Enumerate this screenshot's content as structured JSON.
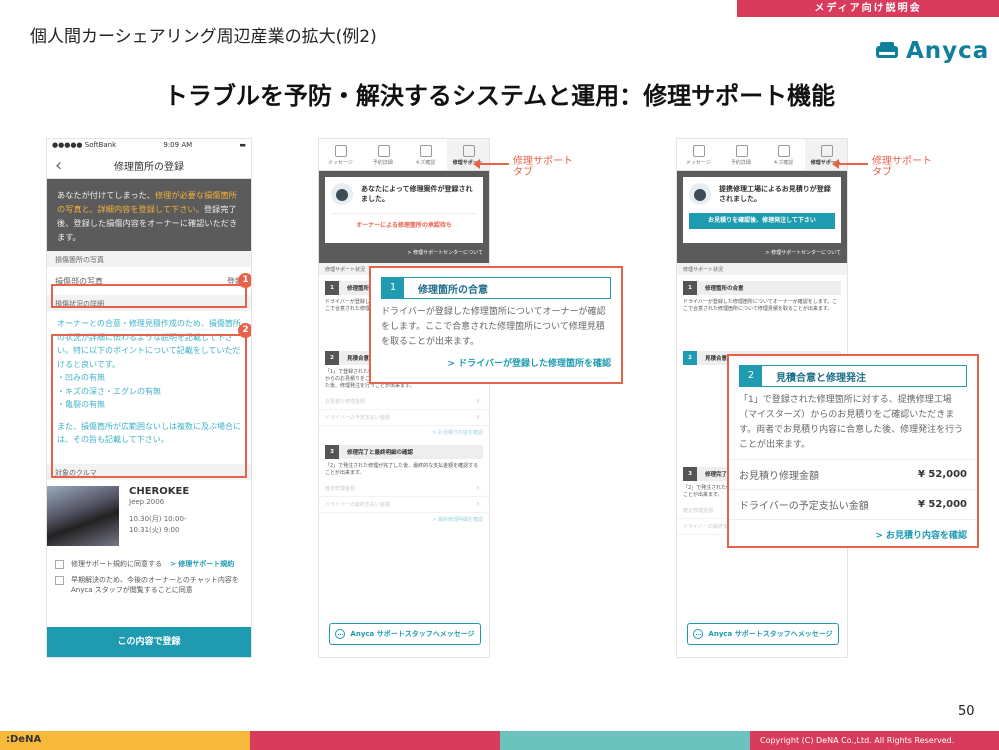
{
  "header": {
    "badge": "メディア向け説明会",
    "subtitle": "個人間カーシェアリング周辺産業の拡大(例2)",
    "logo_text": "Anyca",
    "title": "トラブルを予防・解決するシステムと運用：修理サポート機能"
  },
  "phone1": {
    "status_carrier": "●●●●● SoftBank",
    "status_time": "9:09 AM",
    "nav_title": "修理箇所の登録",
    "intro_1": "あなたが付けてしまった、",
    "intro_hl": "修理が必要な損傷箇所の写真と、詳細内容を登録して下さい。",
    "intro_2": "登録完了後、登録した損傷内容をオーナーに確認いただきます。",
    "photo_section": "損傷箇所の写真",
    "photo_field": "損傷部の写真",
    "photo_action": "登録",
    "detail_section": "損傷状況の詳細",
    "detail_text_1": "オーナーとの合意・修理見積作成のため、損傷箇所の状況が詳細に伝わるような説明を記載して下さい。特に以下のポイントについて記載をしていただけると良いです。",
    "detail_points": [
      "・凹みの有無",
      "・キズの深さ・エグレの有無",
      "・亀裂の有無"
    ],
    "detail_text_2": "また、損傷箇所が広範囲ないしは複数に及ぶ場合には、その旨も記載して下さい。",
    "car_section": "対象のクルマ",
    "car_name": "CHEROKEE",
    "car_model": "Jeep 2006",
    "car_date_1": "10.30(月) 10:00-",
    "car_date_2": "10.31(火) 9:00",
    "check_1": "修理サポート規約に同意する",
    "check_1_link": "> 修理サポート規約",
    "check_2": "早期解決のため、今後のオーナーとのチャット内容を Anyca スタッフが閲覧することに同意",
    "submit": "この内容で登録",
    "marker_1": "1",
    "marker_2": "2"
  },
  "tabs": [
    "メッセージ",
    "予約詳細",
    "キズ確認",
    "修理サポート"
  ],
  "phone2": {
    "banner_msg": "あなたによって修理案件が登録されました。",
    "banner_status": "オーナーによる修理箇所の承認待ち",
    "banner_link": "> 修理サポートセンターについて",
    "status_label": "修理サポート状況",
    "step1": "修理箇所の合意",
    "step1_text": "ドライバーが登録した修理箇所についてオーナーが確認をします。ここで合意された修理箇所について修理見積を取ることが出来ます。",
    "step2": "見積合意と修理発注",
    "step2_text": "「1」で登録された修理箇所に対する、提携修理工場（マイスターズ）からのお見積りをご確認いただきます。両者でお見積り内容に合意した後、修理発注を行うことが出来ます。",
    "step2_row1": "お見積り修理金額",
    "step2_row2": "ドライバーの予定支払い金額",
    "step2_val": "¥ -",
    "step2_link": "> お見積り内容を確認",
    "step3": "修理完了と最終明細の確認",
    "step3_text": "「2」で発注された修理が完了した後、最終的な支払金額を確認することが出来ます。",
    "step3_row1": "確定修理金額",
    "step3_row2": "ドライバーの最終支払い金額",
    "step3_link": "> 最終修理明細を確認",
    "message_button": "Anyca サポートスタッフへメッセージ",
    "annot": "修理サポート\nタブ",
    "callout_num": "1",
    "callout_title": "修理箇所の合意",
    "callout_body": "ドライバーが登録した修理箇所についてオーナーが確認をします。ここで合意された修理箇所について修理見積を取ることが出来ます。",
    "callout_link": "> ドライバーが登録した修理箇所を確認"
  },
  "phone3": {
    "banner_msg": "提携修理工場によるお見積りが登録されました。",
    "banner_button": "お見積りを確認後、修理発注して下さい",
    "banner_link": "> 修理サポートセンターについて",
    "status_label": "修理サポート状況",
    "step1": "修理箇所の合意",
    "step1_text": "ドライバーが登録した修理箇所についてオーナーが確認をします。ここで合意された修理箇所について修理見積を取ることが出来ます。",
    "step2": "見積合意と修理発注",
    "step3": "修理完了と最終明細の確認",
    "step3_text": "「2」で発注された修理が完了した後、最終的な支払金額を確認することが出来ます。",
    "step3_row1": "確定修理金額",
    "step3_row2": "ドライバーの最終支払い金額",
    "step3_val": "¥ -",
    "step3_link": "> 最終修理明細を確認",
    "message_button": "Anyca サポートスタッフへメッセージ",
    "annot": "修理サポート\nタブ",
    "callout_num": "2",
    "callout_title": "見積合意と修理発注",
    "callout_body": "「1」で登録された修理箇所に対する、提携修理工場（マイスターズ）からのお見積りをご確認いただきます。両者でお見積り内容に合意した後、修理発注を行うことが出来ます。",
    "callout_row1": "お見積り修理金額",
    "callout_row1_val": "¥ 52,000",
    "callout_row2": "ドライバーの予定支払い金額",
    "callout_row2_val": "¥ 52,000",
    "callout_link": "> お見積り内容を確認"
  },
  "footer": {
    "page": "50",
    "brand": ":DeNA",
    "copyright": "Copyright (C) DeNA Co.,Ltd. All Rights Reserved.",
    "colors": [
      "#f6b93b",
      "#d93b5c",
      "#6cc2bd",
      "#d93b5c"
    ]
  }
}
